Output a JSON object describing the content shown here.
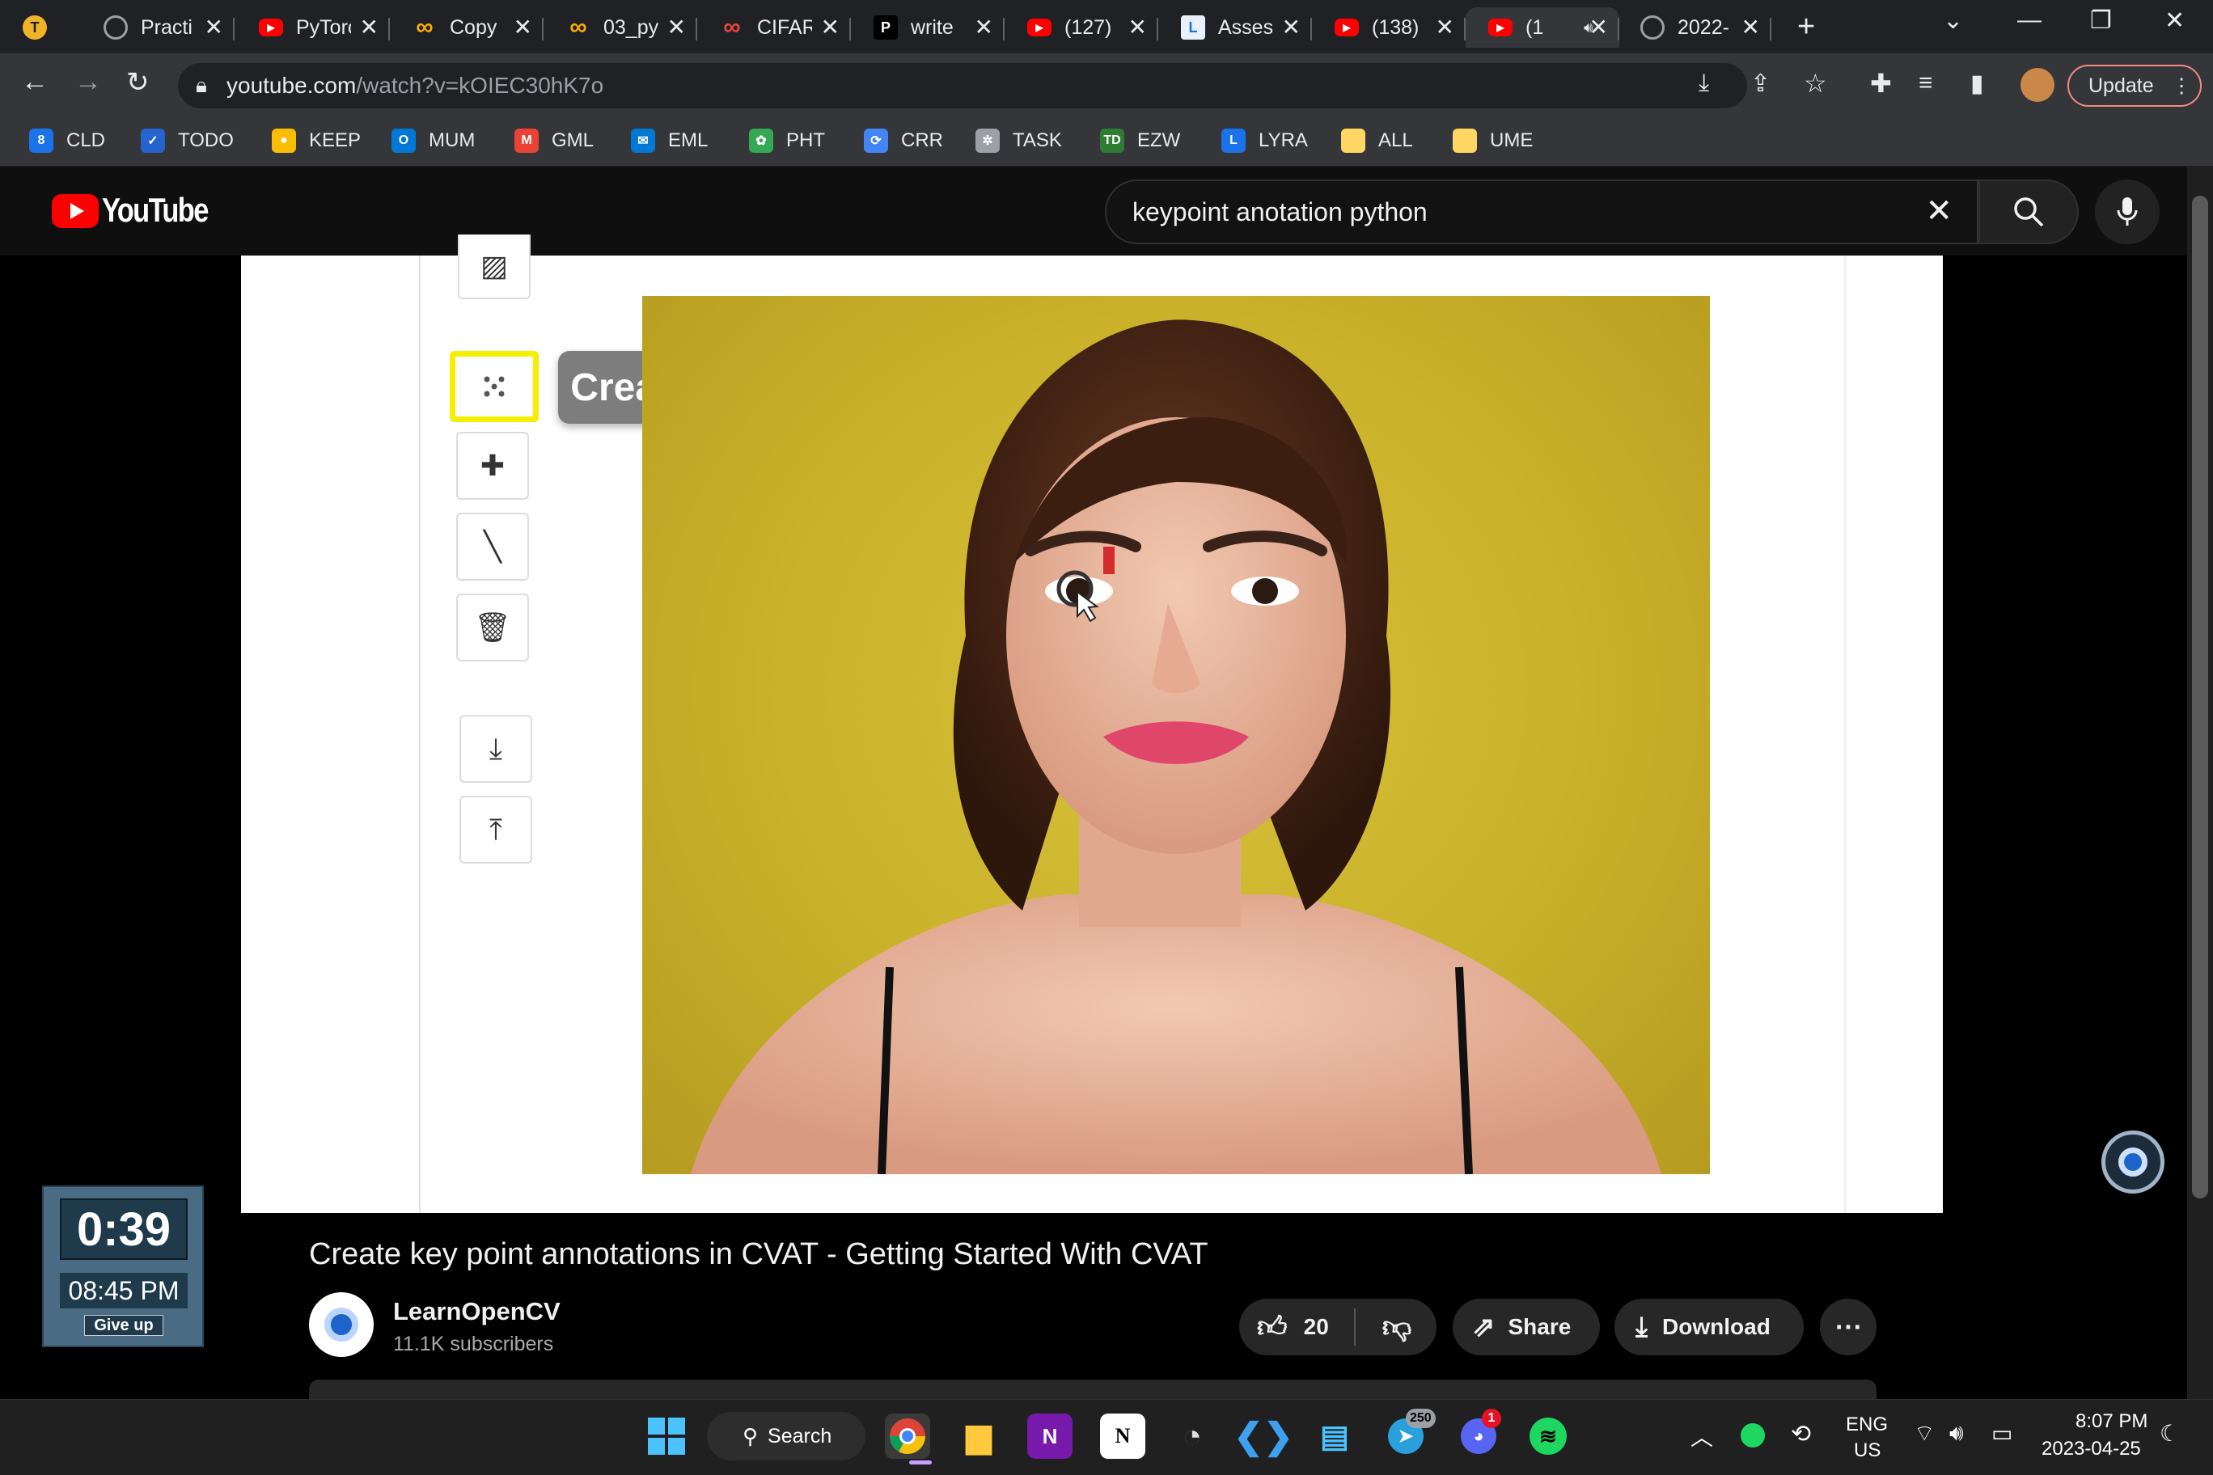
{
  "browser": {
    "tabs": [
      {
        "title": "",
        "favicon": "T",
        "color": "#f0b429"
      },
      {
        "title": "Practi",
        "favicon": "globe",
        "color": "#9aa0a6"
      },
      {
        "title": "PyTorc",
        "favicon": "youtube",
        "color": "#ff0000"
      },
      {
        "title": "Copy",
        "favicon": "colab",
        "color": "#f9ab00"
      },
      {
        "title": "03_py",
        "favicon": "colab",
        "color": "#f9ab00"
      },
      {
        "title": "CIFAR",
        "favicon": "colab",
        "color": "#e8453c"
      },
      {
        "title": "write",
        "favicon": "P",
        "color": "#000000"
      },
      {
        "title": "(127)",
        "favicon": "youtube",
        "color": "#ff0000"
      },
      {
        "title": "Asses",
        "favicon": "L",
        "color": "#1a73e8"
      },
      {
        "title": "(138)",
        "favicon": "youtube",
        "color": "#ff0000"
      },
      {
        "title": "(1",
        "favicon": "youtube",
        "color": "#ff0000",
        "active": true
      },
      {
        "title": "2022-",
        "favicon": "globe",
        "color": "#9aa0a6"
      }
    ],
    "url_host": "youtube.com",
    "url_path": "/watch?v=kOIEC30hK7o",
    "update_label": "Update",
    "bookmarks": [
      {
        "label": "CLD",
        "icon": "calendar-icon",
        "color": "#1a73e8",
        "glyph": "8"
      },
      {
        "label": "TODO",
        "icon": "todo-icon",
        "color": "#2564cf",
        "glyph": "✓"
      },
      {
        "label": "KEEP",
        "icon": "keep-icon",
        "color": "#fbbc04",
        "glyph": "●"
      },
      {
        "label": "MUM",
        "icon": "outlook-icon",
        "color": "#0078d4",
        "glyph": "O"
      },
      {
        "label": "GML",
        "icon": "gmail-icon",
        "color": "#ea4335",
        "glyph": "M"
      },
      {
        "label": "EML",
        "icon": "mail-icon",
        "color": "#0078d4",
        "glyph": "✉"
      },
      {
        "label": "PHT",
        "icon": "photos-icon",
        "color": "#34a853",
        "glyph": "✿"
      },
      {
        "label": "CRR",
        "icon": "refresh-icon",
        "color": "#4285f4",
        "glyph": "⟳"
      },
      {
        "label": "TASK",
        "icon": "task-icon",
        "color": "#9aa0a6",
        "glyph": "✲"
      },
      {
        "label": "EZW",
        "icon": "td-icon",
        "color": "#2e7d32",
        "glyph": "TD"
      },
      {
        "label": "LYRA",
        "icon": "lyra-icon",
        "color": "#1a73e8",
        "glyph": "L"
      },
      {
        "label": "ALL",
        "icon": "note-icon",
        "color": "#fdd663",
        "glyph": " "
      },
      {
        "label": "UME",
        "icon": "note-icon",
        "color": "#fdd663",
        "glyph": " "
      }
    ]
  },
  "youtube": {
    "logo_text": "YouTube",
    "search_value": "keypoint anotation python"
  },
  "video": {
    "tooltip": "Create Points",
    "title": "Create key point annotations in CVAT - Getting Started With CVAT",
    "channel": "LearnOpenCV",
    "subscribers": "11.1K subscribers",
    "likes": "20",
    "share_label": "Share",
    "download_label": "Download"
  },
  "timer_widget": {
    "countdown": "0:39",
    "clock": "08:45 PM",
    "give_up": "Give up"
  },
  "taskbar": {
    "search_label": "Search",
    "telegram_badge": "250",
    "discord_badge": "1",
    "lang_top": "ENG",
    "lang_bottom": "US",
    "time": "8:07 PM",
    "date": "2023-04-25"
  }
}
